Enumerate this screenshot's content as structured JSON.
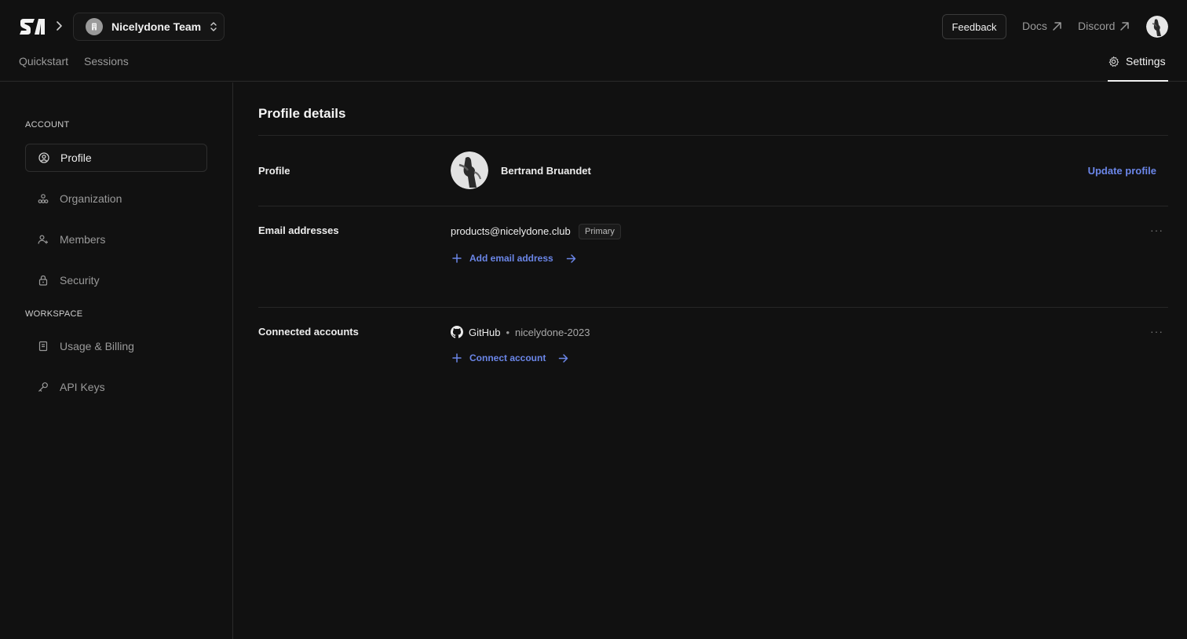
{
  "header": {
    "logo": "stack-logo",
    "team_name": "Nicelydone Team",
    "feedback_label": "Feedback",
    "docs_label": "Docs",
    "discord_label": "Discord",
    "tabs": [
      {
        "label": "Quickstart"
      },
      {
        "label": "Sessions"
      }
    ],
    "settings_label": "Settings"
  },
  "sidebar": {
    "account_heading": "ACCOUNT",
    "workspace_heading": "WORKSPACE",
    "items": [
      {
        "label": "Profile",
        "icon": "user-circle-icon",
        "active": true
      },
      {
        "label": "Organization",
        "icon": "organization-icon"
      },
      {
        "label": "Members",
        "icon": "user-plus-icon"
      },
      {
        "label": "Security",
        "icon": "lock-icon"
      },
      {
        "label": "Usage & Billing",
        "icon": "receipt-icon"
      },
      {
        "label": "API Keys",
        "icon": "key-icon"
      }
    ]
  },
  "main": {
    "title": "Profile details",
    "profile": {
      "label": "Profile",
      "name": "Bertrand Bruandet",
      "update_label": "Update profile"
    },
    "emails": {
      "label": "Email addresses",
      "address": "products@nicelydone.club",
      "badge": "Primary",
      "add_label": "Add email address"
    },
    "connected": {
      "label": "Connected accounts",
      "provider": "GitHub",
      "separator": "•",
      "username": "nicelydone-2023",
      "connect_label": "Connect account"
    },
    "more_label": "···"
  },
  "colors": {
    "background": "#111111",
    "accent_link": "#6b86e8",
    "muted_text": "#9a9a9a",
    "border": "#2a2a2a"
  }
}
